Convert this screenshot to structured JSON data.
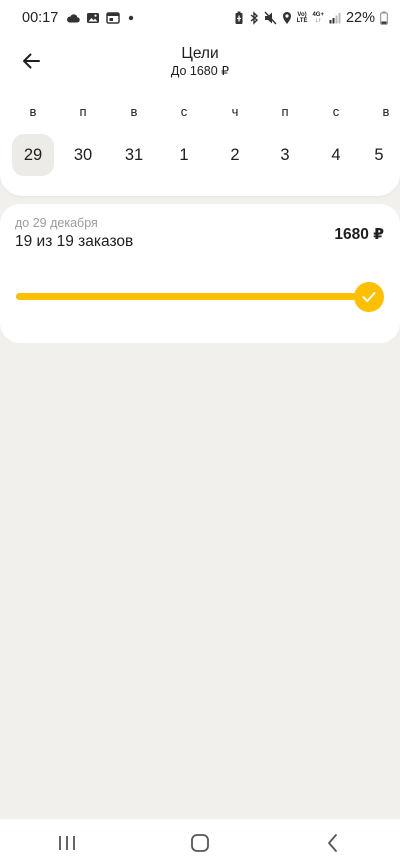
{
  "status_bar": {
    "time": "00:17",
    "battery_percent": "22%",
    "network_top": "Vo)",
    "network_bottom": "LTE",
    "gen_top": "4G+",
    "gen_bottom": "↓↑"
  },
  "header": {
    "title": "Цели",
    "subtitle": "До 1680 ₽",
    "back_icon": "arrow-left-icon"
  },
  "calendar": {
    "weekdays": [
      "в",
      "п",
      "в",
      "с",
      "ч",
      "п",
      "с",
      "в"
    ],
    "dates": [
      "29",
      "30",
      "31",
      "1",
      "2",
      "3",
      "4",
      "5"
    ],
    "selected_index": 0
  },
  "goal": {
    "date_label": "до 29 декабря",
    "orders_label": "19 из 19 заказов",
    "amount": "1680 ₽",
    "progress": 1.0,
    "accent_color": "#fcc000"
  },
  "nav_bar": {
    "icons": [
      "recent-apps-icon",
      "home-icon",
      "back-nav-icon"
    ]
  }
}
